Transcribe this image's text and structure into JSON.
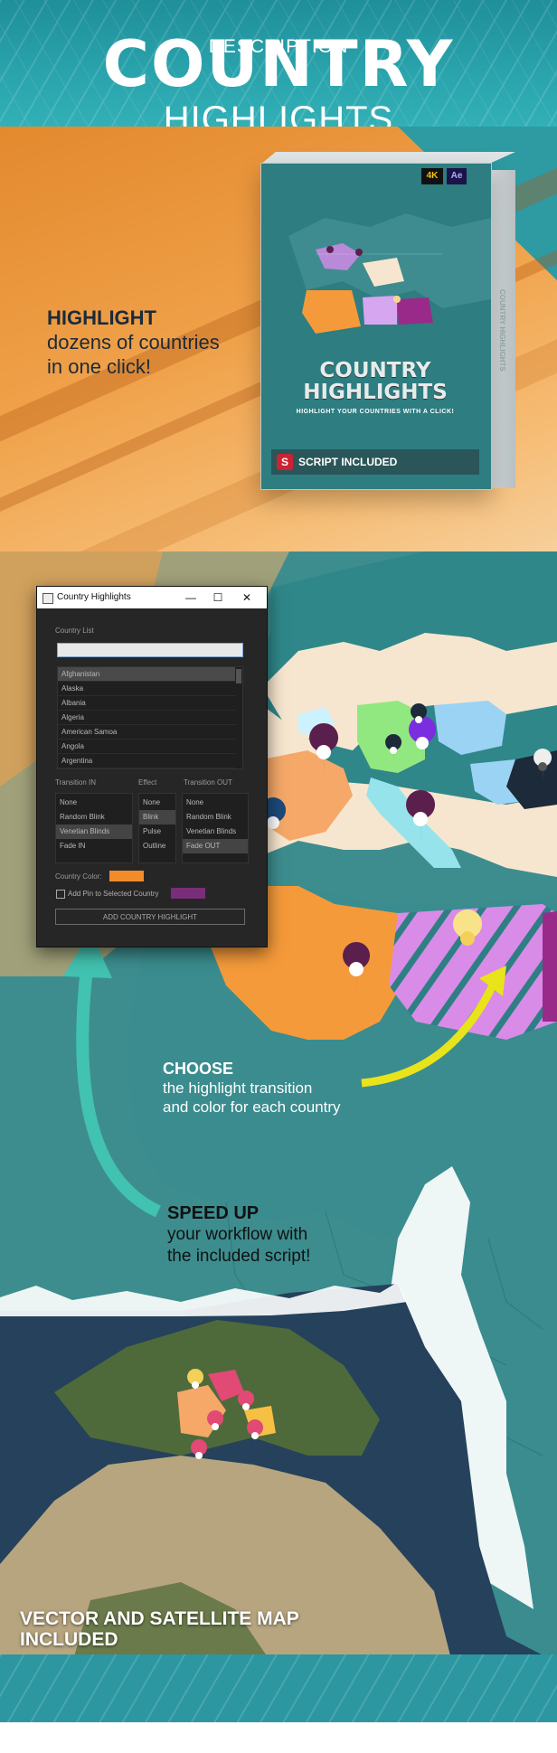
{
  "header": {
    "title": "COUNTRY",
    "subtitle": "HIGHLIGHTS"
  },
  "intro": {
    "headline": "HIGHLIGHT",
    "line1": "dozens of countries",
    "line2": "in one click!"
  },
  "product_box": {
    "badge_4k": "4K",
    "badge_ae": "Ae",
    "title_line1": "COUNTRY",
    "title_line2": "HIGHLIGHTS",
    "tagline": "HIGHLIGHT YOUR COUNTRIES WITH A CLICK!",
    "script_label": "SCRIPT INCLUDED",
    "side_label": "COUNTRY HIGHLIGHTS"
  },
  "dialog": {
    "window_title": "Country Highlights",
    "minimize_glyph": "—",
    "maximize_glyph": "☐",
    "close_glyph": "✕",
    "country_list_label": "Country List",
    "search_value": "",
    "countries": [
      "Afghanistan",
      "Alaska",
      "Albania",
      "Algeria",
      "American Samoa",
      "Angola",
      "Argentina"
    ],
    "transition_in_label": "Transition IN",
    "effect_label": "Effect",
    "transition_out_label": "Transition OUT",
    "transition_in_options": [
      "None",
      "Random Blink",
      "Venetian Blinds",
      "Fade IN"
    ],
    "effect_options": [
      "None",
      "Blink",
      "Pulse",
      "Outline"
    ],
    "transition_out_options": [
      "None",
      "Random Blink",
      "Venetian Blinds",
      "Fade OUT"
    ],
    "country_color_label": "Country Color:",
    "country_color": "#f28b2a",
    "pin_label": "Add Pin to Selected Country",
    "pin_color": "#7a2e7a",
    "add_button_label": "ADD COUNTRY HIGHLIGHT"
  },
  "captions": {
    "choose_title": "CHOOSE",
    "choose_line1": "the highlight transition",
    "choose_line2": "and color for each country",
    "speed_title": "SPEED UP",
    "speed_line1": "your workflow with",
    "speed_line2": "the included script!",
    "vector_line1": "VECTOR AND SATELLITE MAP",
    "vector_line2": "INCLUDED"
  },
  "footer": {
    "description_label": "DESCRIPTION"
  },
  "colors": {
    "teal": "#2e9aa2",
    "orange": "#f28b2a",
    "land": "#f7e6cf",
    "sea": "#3a8a8c",
    "purple_pin": "#5b1f4e"
  }
}
